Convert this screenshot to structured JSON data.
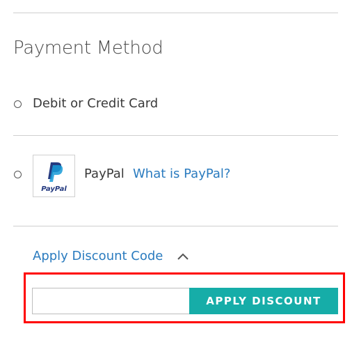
{
  "payment": {
    "title": "Payment Method",
    "options": [
      {
        "label": "Debit or Credit Card",
        "selected": false
      },
      {
        "label": "PayPal",
        "selected": false,
        "logo_text": "PayPal",
        "help_link": "What is PayPal?"
      }
    ]
  },
  "discount": {
    "toggle_label": "Apply Discount Code",
    "expanded": true,
    "input_value": "",
    "input_placeholder": "",
    "button_label": "APPLY DISCOUNT"
  },
  "colors": {
    "accent": "#16ada8",
    "link": "#2a7bbf",
    "highlight": "#ff0000",
    "paypal_dark": "#253b80",
    "paypal_light": "#179bd7"
  }
}
